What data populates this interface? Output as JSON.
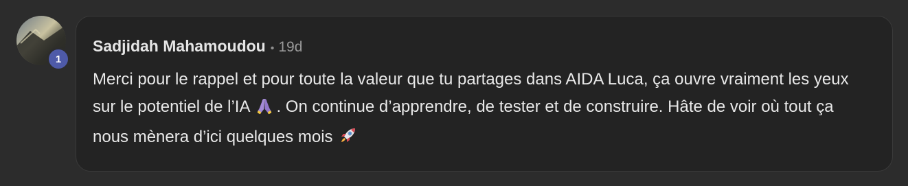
{
  "comment": {
    "author": "Sadjidah Mahamoudou",
    "separator": "•",
    "time_ago": "19d",
    "level": "1",
    "text_part1": "Merci pour le rappel et pour toute la valeur que tu partages dans AIDA Luca, ça ouvre vraiment les yeux sur le potentiel de l’IA",
    "emoji1": "folded-hands-icon",
    "text_part2": ". On continue d’apprendre, de tester et de construire. Hâte de voir où tout ça nous mènera d’ici quelques mois",
    "emoji2": "rocket-icon"
  },
  "colors": {
    "background": "#2c2c2c",
    "bubble": "#232323",
    "badge": "#4e5aa8",
    "text": "#e8e8e8",
    "muted": "#9a9a9a"
  }
}
